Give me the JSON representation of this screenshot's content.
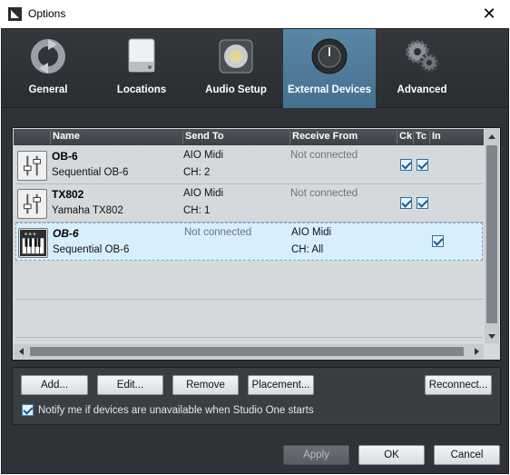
{
  "window": {
    "title": "Options"
  },
  "tabs": [
    {
      "label": "General",
      "icon": "refresh-icon",
      "active": false
    },
    {
      "label": "Locations",
      "icon": "drive-icon",
      "active": false
    },
    {
      "label": "Audio Setup",
      "icon": "speaker-icon",
      "active": false
    },
    {
      "label": "External Devices",
      "icon": "knob-icon",
      "active": true
    },
    {
      "label": "Advanced",
      "icon": "gears-icon",
      "active": false
    }
  ],
  "table": {
    "columns": {
      "name": "Name",
      "send_to": "Send To",
      "receive_from": "Receive From",
      "ck": "Ck",
      "tc": "Tc",
      "in": "In"
    },
    "rows": [
      {
        "name": "OB-6",
        "model": "Sequential OB-6",
        "send_to": "AIO Midi",
        "send_channel": "CH: 2",
        "receive_from": "Not connected",
        "receive_channel": "",
        "icon": "controller-icon",
        "ck": true,
        "tc": true,
        "in": false,
        "selected": false
      },
      {
        "name": "TX802",
        "model": "Yamaha TX802",
        "send_to": "AIO Midi",
        "send_channel": "CH: 1",
        "receive_from": "Not connected",
        "receive_channel": "",
        "icon": "controller-icon",
        "ck": true,
        "tc": true,
        "in": false,
        "selected": false
      },
      {
        "name": "OB-6",
        "model": "Sequential OB-6",
        "send_to": "Not connected",
        "send_channel": "",
        "receive_from": "AIO Midi",
        "receive_channel": "CH: All",
        "icon": "keyboard-icon",
        "ck": false,
        "tc": false,
        "in": true,
        "selected": true
      }
    ]
  },
  "buttons": {
    "add": "Add...",
    "edit": "Edit...",
    "remove": "Remove",
    "placement": "Placement...",
    "reconnect": "Reconnect...",
    "apply": "Apply",
    "ok": "OK",
    "cancel": "Cancel"
  },
  "notify": {
    "label": "Notify me if devices are unavailable when Studio One starts",
    "checked": true
  },
  "colors": {
    "active_tab": "#5583a3",
    "window_bg": "#2f3236",
    "panel_bg": "#d6d9dc",
    "selected_row": "#d7effd"
  }
}
